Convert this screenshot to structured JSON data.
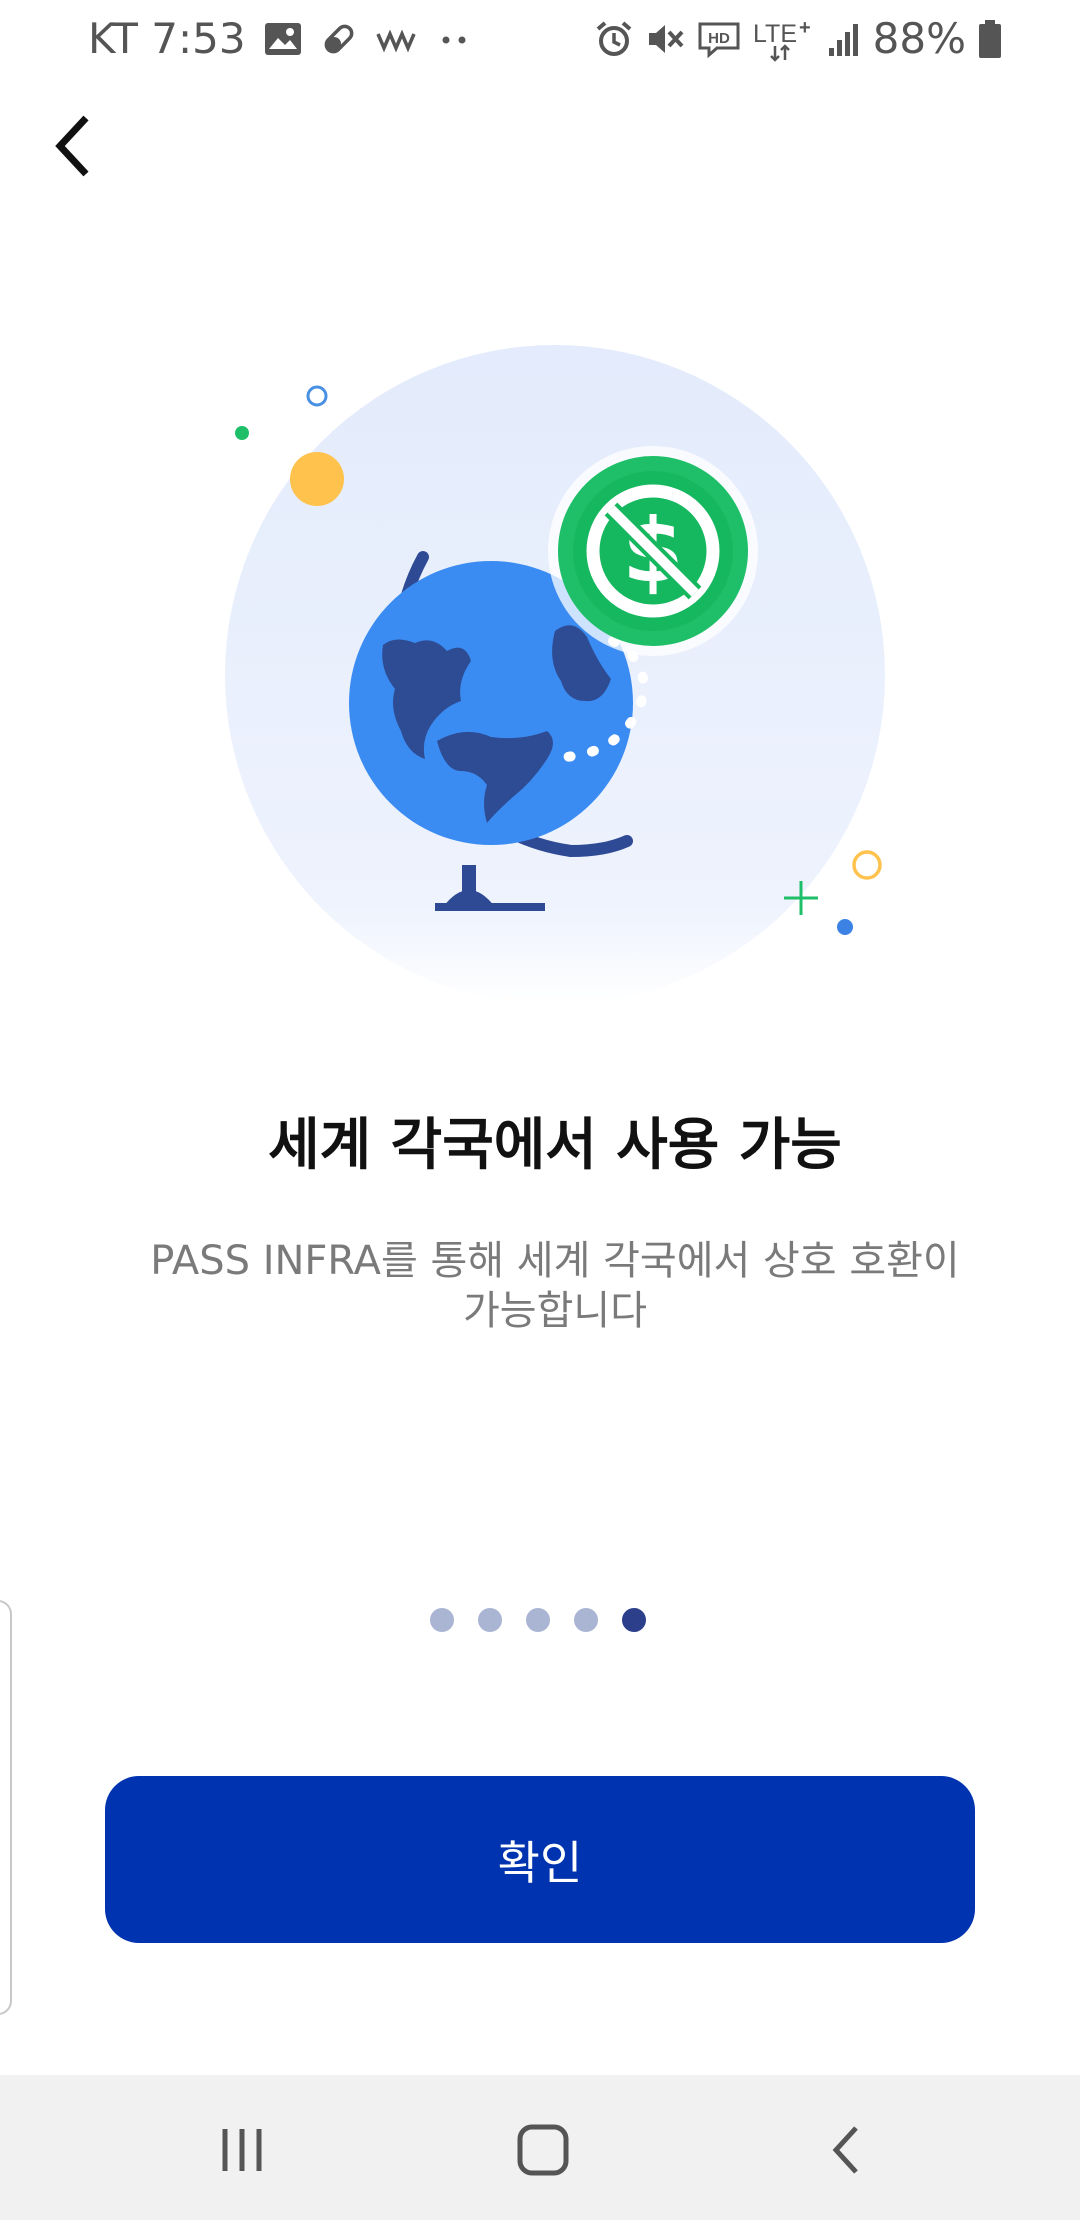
{
  "status_bar": {
    "carrier_time": "KT 7:53",
    "battery_percent": "88%",
    "network": "LTE+",
    "icons": [
      "image-icon",
      "pill-icon",
      "signal-brand-icon",
      "more-dots-icon",
      "alarm-icon",
      "mute-icon",
      "hd-icon",
      "lte-icon",
      "signal-icon",
      "battery-icon"
    ]
  },
  "header": {
    "back_icon": "chevron-left-icon"
  },
  "illustration": {
    "name": "globe-no-dollar-illustration",
    "colors": {
      "circle_bg": "#e6edfc",
      "globe": "#3b8cf2",
      "land": "#2e4c94",
      "stand": "#2f4a94",
      "badge": "#1fbf6a",
      "yellow_dot": "#ffc24d"
    }
  },
  "content": {
    "headline": "세계 각국에서 사용 가능",
    "description": "PASS INFRA를 통해 세계 각국에서 상호 호환이 가능합니다"
  },
  "pager": {
    "total": 5,
    "active_index": 4
  },
  "actions": {
    "confirm_label": "확인",
    "confirm_color": "#0033b0"
  },
  "nav_bar": {
    "buttons": [
      "recent-apps-icon",
      "home-icon",
      "back-icon"
    ]
  }
}
